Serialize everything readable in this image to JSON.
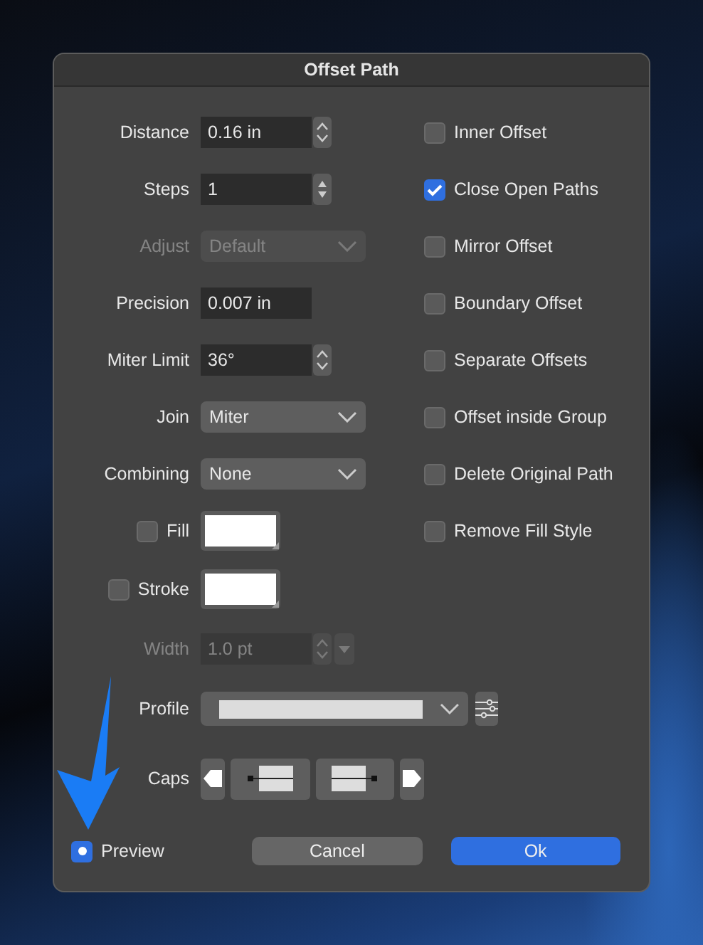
{
  "window": {
    "title": "Offset Path"
  },
  "fields": [
    {
      "kind": "stepper",
      "label": "Distance",
      "value": "0.16 in",
      "disabled": false
    },
    {
      "kind": "spin",
      "label": "Steps",
      "value": "1",
      "disabled": false
    },
    {
      "kind": "select",
      "label": "Adjust",
      "value": "Default",
      "disabled": true
    },
    {
      "kind": "text",
      "label": "Precision",
      "value": "0.007 in",
      "disabled": false
    },
    {
      "kind": "stepper",
      "label": "Miter Limit",
      "value": "36°",
      "disabled": false
    },
    {
      "kind": "select",
      "label": "Join",
      "value": "Miter",
      "disabled": false
    },
    {
      "kind": "select",
      "label": "Combining",
      "value": "None",
      "disabled": false
    },
    {
      "kind": "color",
      "label": "Fill",
      "checked": false,
      "disabled": false
    },
    {
      "kind": "color",
      "label": "Stroke",
      "checked": false,
      "disabled": false
    },
    {
      "kind": "width",
      "label": "Width",
      "value": "1.0 pt",
      "disabled": true
    },
    {
      "kind": "profile",
      "label": "Profile",
      "disabled": false
    },
    {
      "kind": "caps",
      "label": "Caps",
      "disabled": false
    }
  ],
  "options": [
    {
      "label": "Inner Offset",
      "checked": false
    },
    {
      "label": "Close Open Paths",
      "checked": true
    },
    {
      "label": "Mirror Offset",
      "checked": false
    },
    {
      "label": "Boundary Offset",
      "checked": false
    },
    {
      "label": "Separate Offsets",
      "checked": false
    },
    {
      "label": "Offset inside Group",
      "checked": false
    },
    {
      "label": "Delete Original Path",
      "checked": false
    },
    {
      "label": "Remove Fill Style",
      "checked": false
    }
  ],
  "preview": {
    "label": "Preview",
    "checked": true
  },
  "buttons": [
    {
      "label": "Cancel",
      "primary": false
    },
    {
      "label": "Ok",
      "primary": true
    }
  ]
}
